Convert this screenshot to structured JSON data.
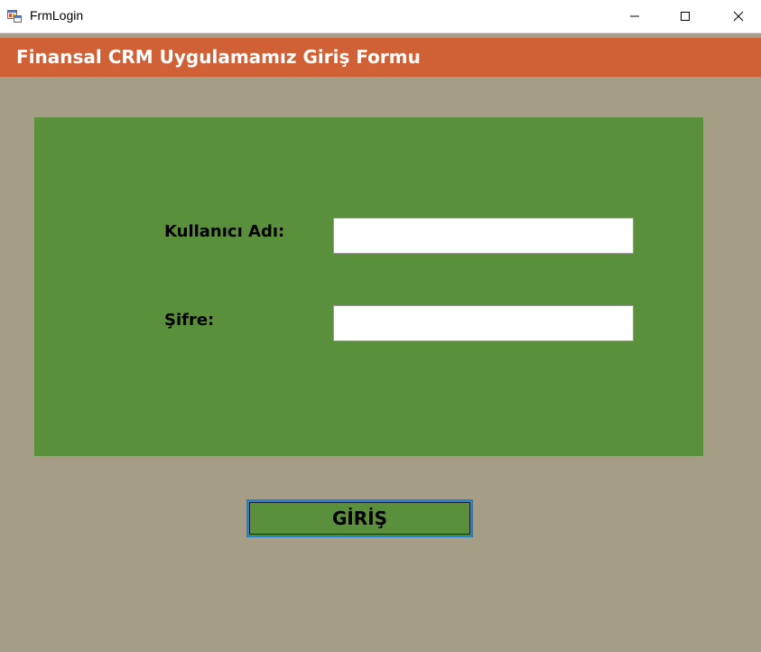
{
  "window": {
    "title": "FrmLogin",
    "icon": "winforms-app-icon"
  },
  "header": {
    "title": "Finansal CRM Uygulamamız Giriş Formu"
  },
  "form": {
    "username_label": "Kullanıcı Adı:",
    "username_value": "",
    "password_label": "Şifre:",
    "password_value": "",
    "submit_label": "GİRİŞ"
  },
  "colors": {
    "background": "#a59d85",
    "header": "#d06137",
    "panel": "#5a8f3b",
    "button_focus_border": "#1f7fd6"
  }
}
